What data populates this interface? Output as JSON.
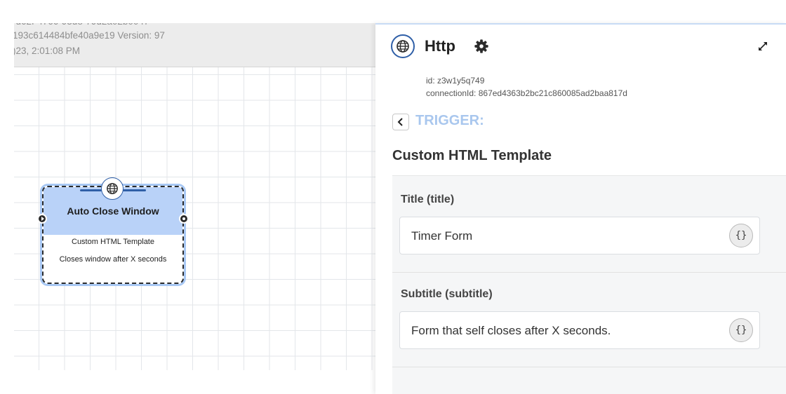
{
  "canvas": {
    "meta_line0": "-d62f-4766-93d8-79d2a02b0047",
    "meta_line1": "193c614484bfe40a9e19 Version: 97",
    "meta_line2": ")23, 2:01:08 PM",
    "node": {
      "title": "Auto Close Window",
      "template": "Custom HTML Template",
      "description": "Closes window after X seconds",
      "icon": "globe-icon"
    }
  },
  "panel": {
    "app_name": "Http",
    "app_icon": "globe-icon",
    "id_text": "id: z3w1y5q749",
    "connection_text": "connectionId: 867ed4363b2bc21c860085ad2baa817d",
    "trigger_label": "TRIGGER:",
    "section_title": "Custom HTML Template",
    "fields": [
      {
        "label": "Title (title)",
        "value": "Timer Form",
        "var_button": "{}"
      },
      {
        "label": "Subtitle (subtitle)",
        "value": "Form that self closes after X seconds.",
        "var_button": "{}"
      }
    ]
  },
  "colors": {
    "accent": "#2f5fa7",
    "node_header": "#b9d2f8",
    "trigger": "#a9c7ee"
  }
}
